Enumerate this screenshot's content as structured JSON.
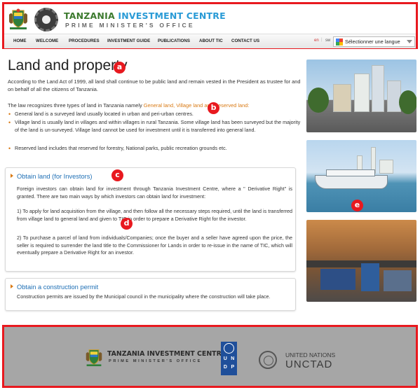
{
  "header": {
    "org_name_part1": "TANZANIA",
    "org_name_part2": "INVESTMENT CENTRE",
    "org_subtitle": "PRIME MINISTER'S OFFICE"
  },
  "nav": {
    "items": [
      "HOME",
      "WELCOME",
      "PROCEDURES",
      "INVESTMENT GUIDE",
      "PUBLICATIONS",
      "ABOUT TIC",
      "CONTACT US"
    ],
    "lang_en": "en",
    "lang_sep": "|",
    "lang_sw": "sw",
    "translate_label": "Sélectionner une langue"
  },
  "annotations": [
    "a",
    "b",
    "c",
    "d",
    "e"
  ],
  "main": {
    "title": "Land and property",
    "intro": "According to the Land Act of 1999, all land shall continue to be public land and remain vested in the President as trustee for and on behalf of all the citizens of Tanzania.",
    "types_lead": "The law recognizes three types of land in Tanzania namely ",
    "types_link": "General land, Village land and Reserved land:",
    "bullets": [
      "General land is a surveyed land usually located in urban and peri-urban centres.",
      "Village land is usually land in villages and within villages in rural Tanzania. Some village land has been surveyed but the majority of the land is un-surveyed. Village land cannot be used for investment until it is transferred into general land.",
      "Reserved land includes that reserved for forestry, National parks, public recreation grounds etc."
    ]
  },
  "obtain_land": {
    "heading": "Obtain land (for Investors)",
    "para1": "Foreign investors can obtain land for investment through Tanzania Investment Centre, where a \" Derivative Right\" is granted. There are two main ways by which investors can obtain land for investment:",
    "para2": "1) To apply for land acquisition from the village, and then follow all the necessary steps required, until the land is transferred from village land to general land and given to TIC in order to prepare a Derivative Right for the investor.",
    "para3": "2) To purchase a parcel of land from individuals/Companies; once the buyer and a seller have agreed upon the price, the seller is required to surrender the land title to the Commissioner for Lands in order to re-issue in the name of TIC, which will eventually prepare a Derivative Right for an investor."
  },
  "construction": {
    "heading": "Obtain a construction permit",
    "text": "Construction permits are issued by the Municipal council in the municipality where the construction will take place."
  },
  "footer": {
    "tic_name": "TANZANIA INVESTMENT CENTRE",
    "tic_sub": "PRIME MINISTER'S OFFICE",
    "undp_letters": [
      "U",
      "N",
      "D",
      "P"
    ],
    "un_name": "UNITED NATIONS",
    "unctad": "UNCTAD"
  },
  "colors": {
    "highlight_border": "#e8191f",
    "link_blue": "#1e6fb5",
    "accent_orange": "#d97a14",
    "footer_bg": "#a6a6a6",
    "undp_blue": "#1f4f9a"
  }
}
